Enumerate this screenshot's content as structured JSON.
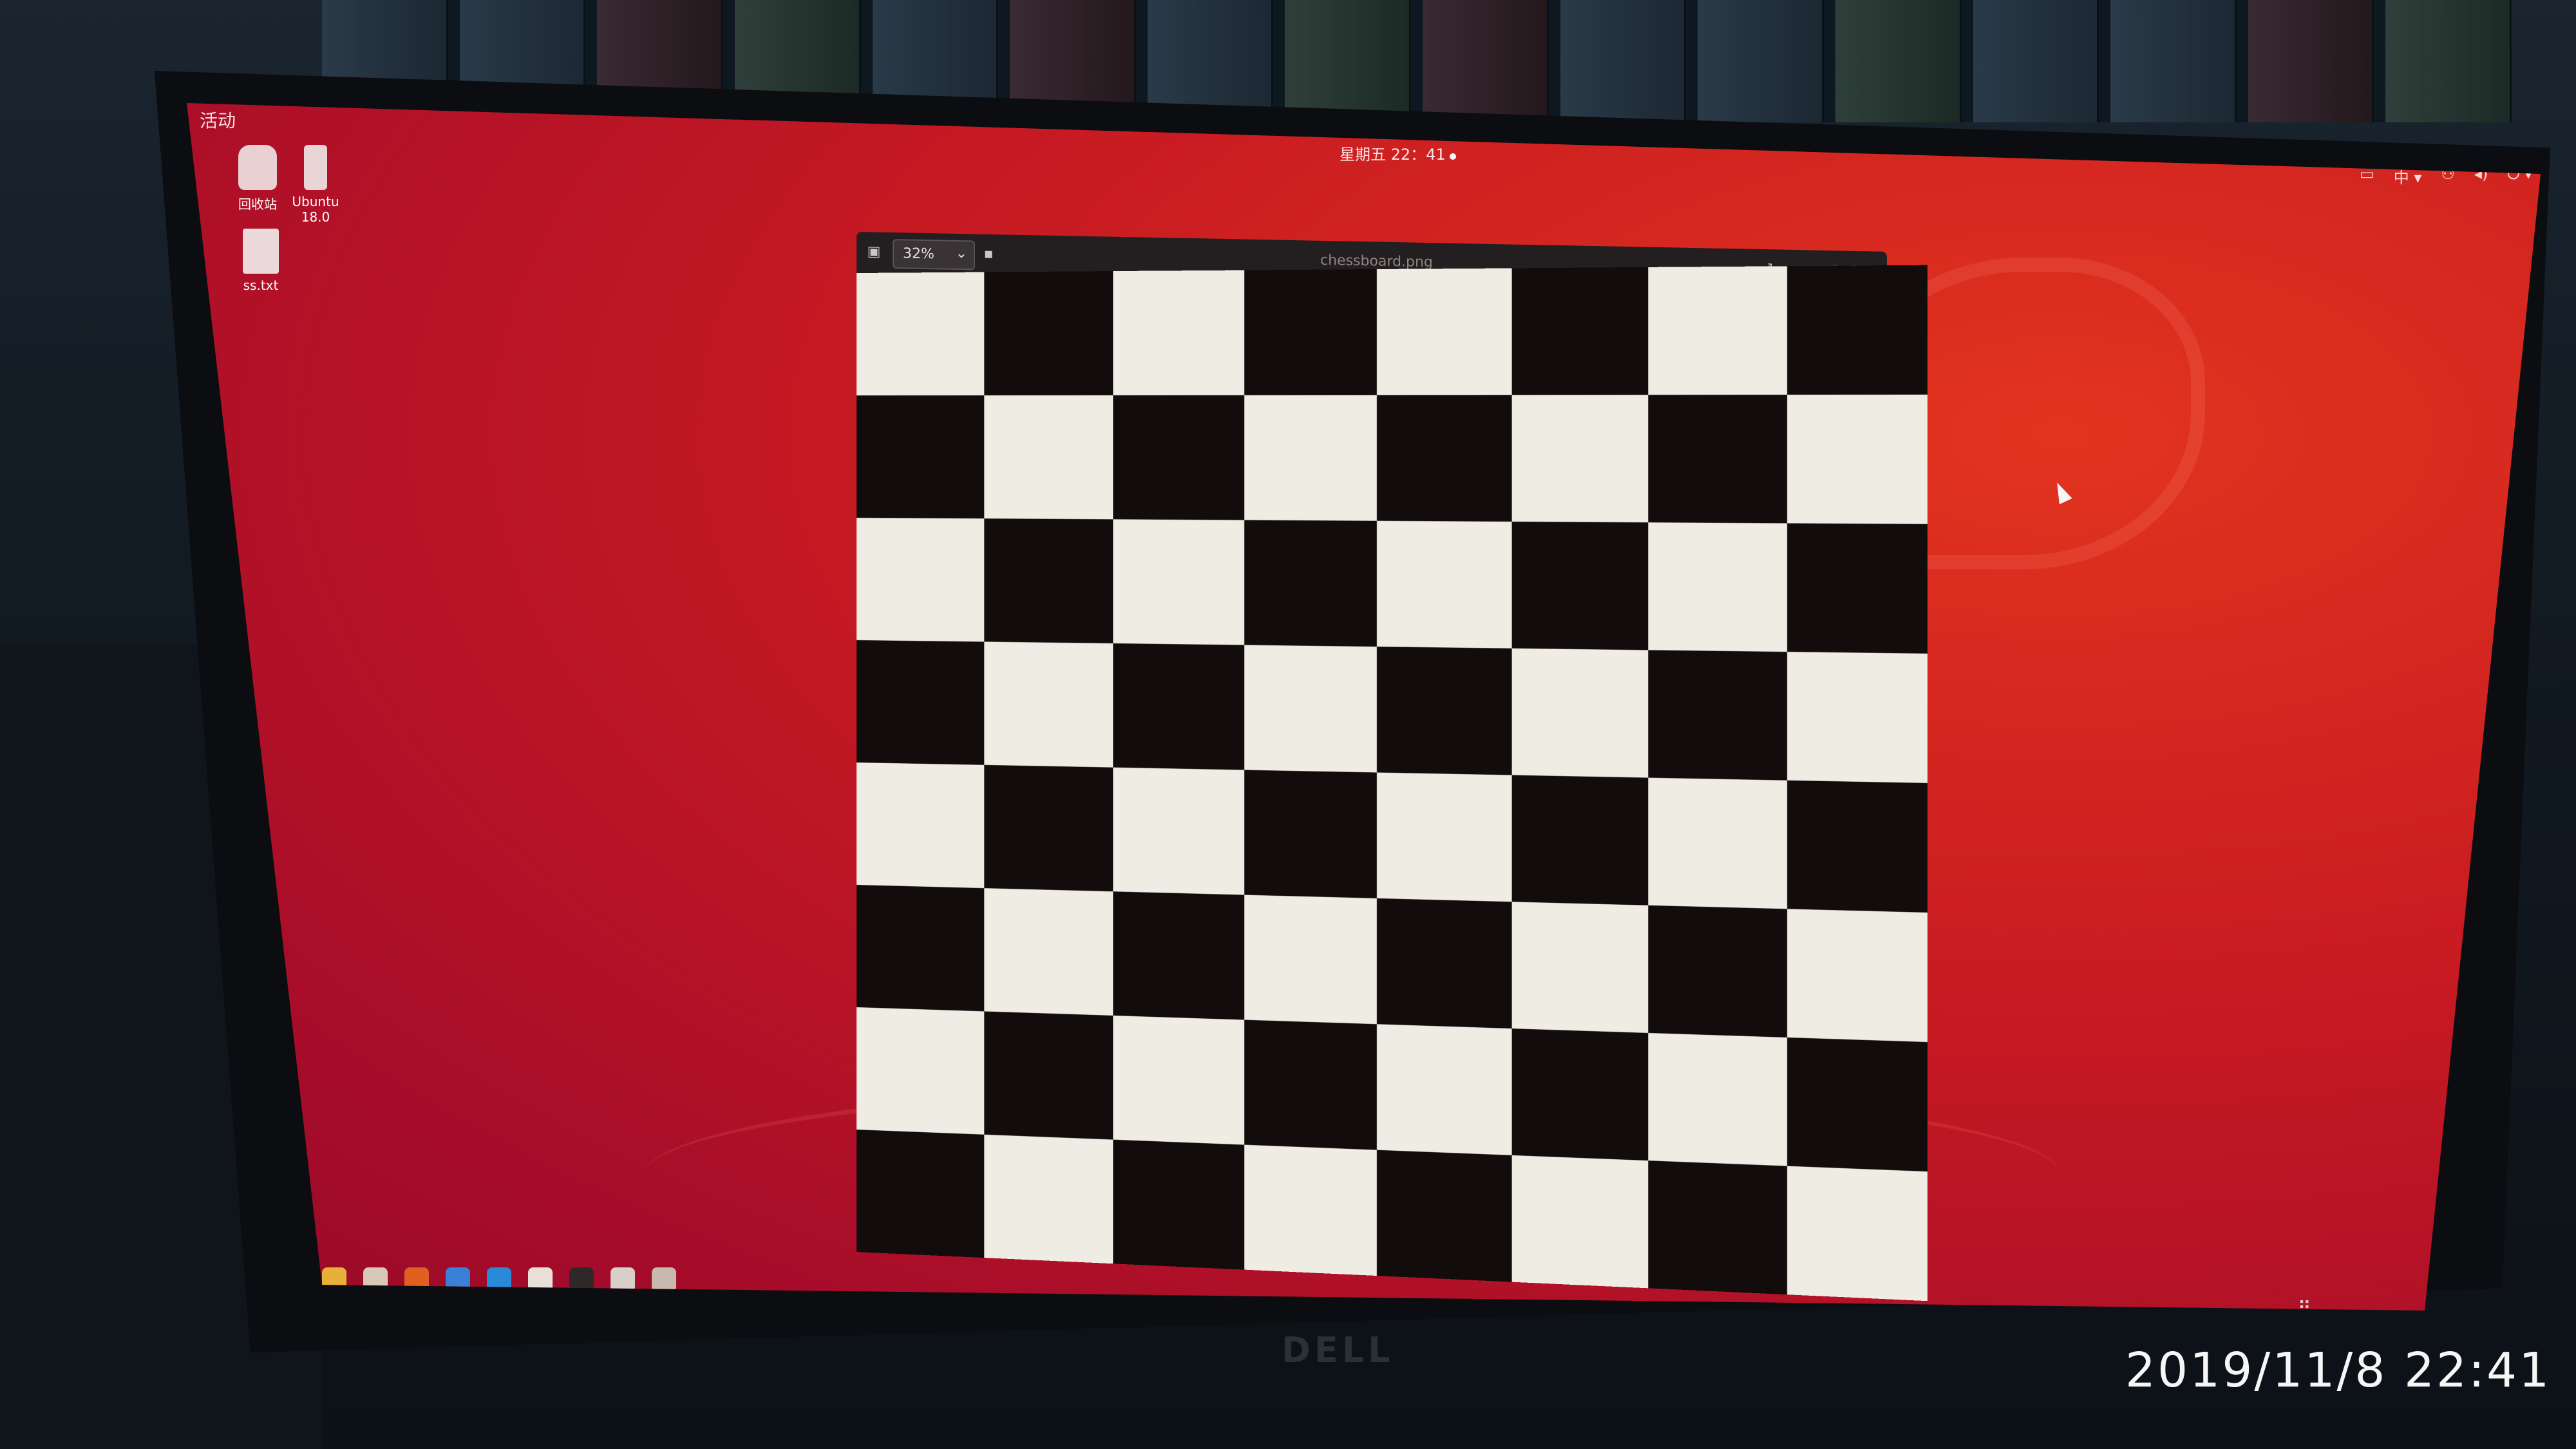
{
  "topbar": {
    "activities_label": "活动",
    "clock_text": "星期五 22：41",
    "tray": {
      "input_method": "中 ▾",
      "network_icon": "network-icon",
      "volume_icon": "volume-icon",
      "power_icon": "power-icon"
    }
  },
  "desktop_icons": [
    {
      "label": "回收站",
      "icon": "trash-icon"
    },
    {
      "label": "Ubuntu 18.0",
      "icon": "usb-drive-icon"
    },
    {
      "label": "ss.txt",
      "icon": "text-file-icon"
    }
  ],
  "viewer": {
    "zoom": "32%",
    "title": "chessboard.png",
    "board": {
      "rows": 8,
      "cols": 8,
      "first_square": "white"
    }
  },
  "dock": {
    "apps": [
      {
        "name": "chrome-icon",
        "color": "#e8b038"
      },
      {
        "name": "files-icon",
        "color": "#d8c8b8"
      },
      {
        "name": "software-center-icon",
        "color": "#e06020"
      },
      {
        "name": "help-icon",
        "color": "#3a80d8"
      },
      {
        "name": "vscode-icon",
        "color": "#2a8ad8"
      },
      {
        "name": "text-editor-icon",
        "color": "#e8e0d8"
      },
      {
        "name": "terminal-icon",
        "color": "#302828"
      },
      {
        "name": "image-viewer-icon",
        "color": "#d8d0c8"
      },
      {
        "name": "screenshot-icon",
        "color": "#c8b8b0"
      }
    ],
    "show_apps_icon": "grid-icon"
  },
  "photo_timestamp": "2019/11/8  22:41",
  "monitor_brand": "DELL",
  "colors": {
    "desktop_red": "#c71a22",
    "window_dark": "#231e20",
    "board_white": "#efece3",
    "board_black": "#120c0d"
  }
}
